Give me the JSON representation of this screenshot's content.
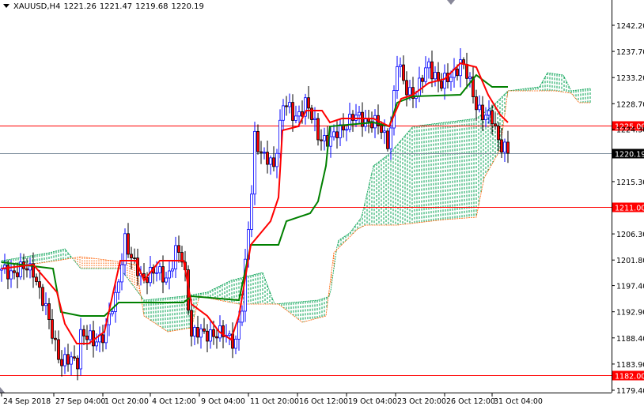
{
  "header": {
    "symbol": "XAUUSD,H4",
    "open": "1221.26",
    "high": "1221.47",
    "low": "1219.68",
    "close": "1220.19"
  },
  "chart_data": {
    "type": "candlestick",
    "title": "XAUUSD,H4",
    "ylim": [
      1179.4,
      1242.2
    ],
    "y_ticks": [
      "1242.20",
      "1237.70",
      "1233.20",
      "1228.70",
      "1224.30",
      "1215.30",
      "1206.30",
      "1201.80",
      "1197.40",
      "1192.90",
      "1188.40",
      "1183.90",
      "1179.40"
    ],
    "x_ticks": [
      {
        "i": 0,
        "label": "24 Sep 2018"
      },
      {
        "i": 16.5,
        "label": "27 Sep 04:00"
      },
      {
        "i": 32,
        "label": "1 Oct 20:00"
      },
      {
        "i": 47,
        "label": "4 Oct 12:00"
      },
      {
        "i": 62.5,
        "label": "9 Oct 04:00"
      },
      {
        "i": 78,
        "label": "11 Oct 20:00"
      },
      {
        "i": 93.5,
        "label": "16 Oct 12:00"
      },
      {
        "i": 109,
        "label": "19 Oct 04:00"
      },
      {
        "i": 124.5,
        "label": "23 Oct 20:00"
      },
      {
        "i": 140,
        "label": "26 Oct 12:00"
      },
      {
        "i": 155,
        "label": "31 Oct 04:00"
      }
    ],
    "close_keypoints": [
      [
        0,
        1199.65
      ],
      [
        10,
        1200.33
      ],
      [
        12.5,
        1195.58
      ],
      [
        19,
        1184.02
      ],
      [
        24,
        1184.7
      ],
      [
        25,
        1189.46
      ],
      [
        29,
        1187.42
      ],
      [
        32.5,
        1189.46
      ],
      [
        36,
        1194.9
      ],
      [
        39,
        1205.77
      ],
      [
        41,
        1201.69
      ],
      [
        44,
        1198.97
      ],
      [
        47.5,
        1199.65
      ],
      [
        52.5,
        1198.97
      ],
      [
        55,
        1203.05
      ],
      [
        57.5,
        1201.69
      ],
      [
        60,
        1189.46
      ],
      [
        64,
        1188.78
      ],
      [
        66,
        1189.46
      ],
      [
        70,
        1188.78
      ],
      [
        74,
        1188.1
      ],
      [
        76,
        1193.54
      ],
      [
        79,
        1213.93
      ],
      [
        80,
        1223.44
      ],
      [
        82.5,
        1219.36
      ],
      [
        86,
        1218.0
      ],
      [
        89,
        1228.88
      ],
      [
        92.5,
        1226.16
      ],
      [
        96,
        1228.88
      ],
      [
        100,
        1223.44
      ],
      [
        104,
        1222.08
      ],
      [
        107.5,
        1224.8
      ],
      [
        111,
        1226.16
      ],
      [
        115,
        1226.16
      ],
      [
        119,
        1224.8
      ],
      [
        122.5,
        1222.08
      ],
      [
        125,
        1235.68
      ],
      [
        127.5,
        1231.6
      ],
      [
        131,
        1230.24
      ],
      [
        135,
        1235.68
      ],
      [
        139,
        1231.6
      ],
      [
        142.5,
        1234.04
      ],
      [
        145,
        1235.68
      ],
      [
        147.5,
        1232.96
      ],
      [
        150,
        1228.88
      ],
      [
        152.5,
        1226.16
      ],
      [
        155,
        1226.16
      ],
      [
        157.5,
        1222.08
      ],
      [
        160,
        1220.19
      ]
    ],
    "tenkan_sen": [
      [
        0,
        1200.33
      ],
      [
        10,
        1201.01
      ],
      [
        17.5,
        1196.26
      ],
      [
        20,
        1190.82
      ],
      [
        23.75,
        1187.42
      ],
      [
        27.5,
        1187.42
      ],
      [
        32.5,
        1189.46
      ],
      [
        37.5,
        1201.69
      ],
      [
        42.5,
        1201.69
      ],
      [
        45,
        1198.29
      ],
      [
        50,
        1201.69
      ],
      [
        57.5,
        1201.69
      ],
      [
        60,
        1194.22
      ],
      [
        65,
        1192.18
      ],
      [
        68.75,
        1189.46
      ],
      [
        72.5,
        1188.1
      ],
      [
        75,
        1192.18
      ],
      [
        78.75,
        1204.41
      ],
      [
        85,
        1208.49
      ],
      [
        87.5,
        1212.57
      ],
      [
        88.75,
        1224.12
      ],
      [
        93.75,
        1224.8
      ],
      [
        96.25,
        1227.52
      ],
      [
        101.25,
        1227.52
      ],
      [
        103.75,
        1225.48
      ],
      [
        107.5,
        1226.16
      ],
      [
        117.5,
        1226.16
      ],
      [
        122.5,
        1224.8
      ],
      [
        126.25,
        1229.56
      ],
      [
        130,
        1230.24
      ],
      [
        135,
        1232.28
      ],
      [
        140,
        1232.96
      ],
      [
        145,
        1235.68
      ],
      [
        150,
        1235.0
      ],
      [
        153.75,
        1230.24
      ],
      [
        157.5,
        1226.84
      ],
      [
        160,
        1225.48
      ]
    ],
    "kijun_sen": [
      [
        0,
        1201.42
      ],
      [
        16.25,
        1200.33
      ],
      [
        18.75,
        1192.86
      ],
      [
        25,
        1192.18
      ],
      [
        32.5,
        1192.18
      ],
      [
        37,
        1194.49
      ],
      [
        57.5,
        1194.49
      ],
      [
        60,
        1195.58
      ],
      [
        75,
        1194.9
      ],
      [
        78.75,
        1204.41
      ],
      [
        87.5,
        1204.41
      ],
      [
        90,
        1208.49
      ],
      [
        97.5,
        1209.85
      ],
      [
        100,
        1211.89
      ],
      [
        102.5,
        1218.0
      ],
      [
        103.75,
        1224.8
      ],
      [
        117.5,
        1225.48
      ],
      [
        122.5,
        1224.8
      ],
      [
        125,
        1228.88
      ],
      [
        130,
        1229.97
      ],
      [
        145,
        1230.24
      ],
      [
        150,
        1233.64
      ],
      [
        155,
        1231.6
      ],
      [
        160,
        1231.6
      ]
    ],
    "senkou_span_a": [
      [
        0,
        1201.69
      ],
      [
        15,
        1203.05
      ],
      [
        20,
        1203.73
      ],
      [
        25,
        1200.33
      ],
      [
        37.5,
        1200.33
      ],
      [
        45,
        1194.9
      ],
      [
        57.5,
        1195.58
      ],
      [
        65,
        1196.26
      ],
      [
        72.5,
        1198.29
      ],
      [
        77.5,
        1198.97
      ],
      [
        82.5,
        1199.65
      ],
      [
        86.25,
        1194.22
      ],
      [
        100,
        1194.9
      ],
      [
        103.75,
        1195.58
      ],
      [
        106.25,
        1205.09
      ],
      [
        110,
        1206.45
      ],
      [
        113.75,
        1209.17
      ],
      [
        117.5,
        1218.0
      ],
      [
        122.5,
        1220.04
      ],
      [
        130,
        1224.8
      ],
      [
        140,
        1225.48
      ],
      [
        150,
        1226.16
      ],
      [
        155,
        1228.2
      ],
      [
        160,
        1230.92
      ],
      [
        170,
        1231.6
      ],
      [
        172.5,
        1234.04
      ],
      [
        177.5,
        1233.64
      ],
      [
        180,
        1230.92
      ],
      [
        186,
        1231.33
      ]
    ],
    "senkou_span_b": [
      [
        0,
        1200.33
      ],
      [
        17.5,
        1201.69
      ],
      [
        25,
        1202.37
      ],
      [
        35,
        1201.69
      ],
      [
        42.5,
        1201.01
      ],
      [
        45,
        1192.18
      ],
      [
        52.5,
        1189.46
      ],
      [
        60,
        1190.14
      ],
      [
        62.5,
        1195.58
      ],
      [
        75,
        1194.22
      ],
      [
        85,
        1194.22
      ],
      [
        87.5,
        1194.22
      ],
      [
        95,
        1191.09
      ],
      [
        102.5,
        1192.18
      ],
      [
        105,
        1203.05
      ],
      [
        112.5,
        1207.13
      ],
      [
        115,
        1207.81
      ],
      [
        125,
        1207.81
      ],
      [
        140,
        1208.76
      ],
      [
        150,
        1209.17
      ],
      [
        152.5,
        1215.97
      ],
      [
        157.5,
        1220.72
      ],
      [
        160,
        1230.92
      ],
      [
        170,
        1230.92
      ],
      [
        175,
        1230.92
      ],
      [
        180,
        1230.51
      ],
      [
        182.5,
        1228.88
      ],
      [
        186,
        1228.88
      ]
    ],
    "horizontal_levels": [
      {
        "price": 1225.0,
        "label": "1225.00",
        "color": "#ff0000"
      },
      {
        "price": 1220.19,
        "label": "1220.19",
        "color": "#000000"
      },
      {
        "price": 1211.0,
        "label": "1211.00",
        "color": "#ff0000"
      },
      {
        "price": 1182.0,
        "label": "1182.00",
        "color": "#ff0000"
      }
    ]
  },
  "colors": {
    "bull": "#0000ff",
    "bear": "#ff0000",
    "tenkan": "#ff0000",
    "kijun": "#008000",
    "cloud_bull": "#00a050",
    "cloud_bear": "#ff6000"
  }
}
